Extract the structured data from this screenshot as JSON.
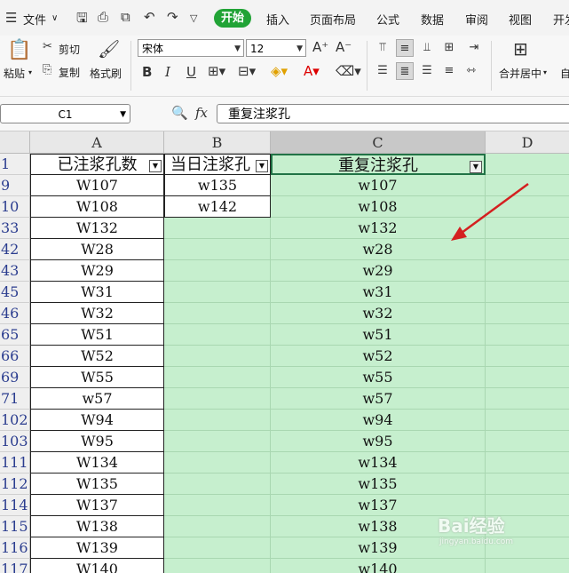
{
  "menubar": {
    "file_label": "文件",
    "tabs": [
      "开始",
      "插入",
      "页面布局",
      "公式",
      "数据",
      "审阅",
      "视图",
      "开发"
    ],
    "active_tab": "开始"
  },
  "ribbon": {
    "paste": "粘贴",
    "cut": "剪切",
    "copy": "复制",
    "format_painter": "格式刷",
    "font_name": "宋体",
    "font_size": "12",
    "merge_center": "合并居中",
    "auto": "自"
  },
  "formula_bar": {
    "cell_ref": "C1",
    "fx": "fx",
    "formula": "重复注浆孔"
  },
  "columns": [
    "A",
    "B",
    "C",
    "D"
  ],
  "selected_column": "C",
  "header_row": {
    "row": "1",
    "A": "已注浆孔数",
    "B": "当日注浆孔",
    "C": "重复注浆孔"
  },
  "rows": [
    {
      "row": "9",
      "A": "W107",
      "B": "w135",
      "C": "w107"
    },
    {
      "row": "10",
      "A": "W108",
      "B": "w142",
      "C": "w108"
    },
    {
      "row": "33",
      "A": "W132",
      "B": "",
      "C": "w132"
    },
    {
      "row": "42",
      "A": "W28",
      "B": "",
      "C": "w28"
    },
    {
      "row": "43",
      "A": "W29",
      "B": "",
      "C": "w29"
    },
    {
      "row": "45",
      "A": "W31",
      "B": "",
      "C": "w31"
    },
    {
      "row": "46",
      "A": "W32",
      "B": "",
      "C": "w32"
    },
    {
      "row": "65",
      "A": "W51",
      "B": "",
      "C": "w51"
    },
    {
      "row": "66",
      "A": "W52",
      "B": "",
      "C": "w52"
    },
    {
      "row": "69",
      "A": "W55",
      "B": "",
      "C": "w55"
    },
    {
      "row": "71",
      "A": "w57",
      "B": "",
      "C": "w57"
    },
    {
      "row": "102",
      "A": "W94",
      "B": "",
      "C": "w94"
    },
    {
      "row": "103",
      "A": "W95",
      "B": "",
      "C": "w95"
    },
    {
      "row": "111",
      "A": "W134",
      "B": "",
      "C": "w134"
    },
    {
      "row": "112",
      "A": "W135",
      "B": "",
      "C": "w135"
    },
    {
      "row": "114",
      "A": "W137",
      "B": "",
      "C": "w137"
    },
    {
      "row": "115",
      "A": "W138",
      "B": "",
      "C": "w138"
    },
    {
      "row": "116",
      "A": "W139",
      "B": "",
      "C": "w139"
    },
    {
      "row": "117",
      "A": "W140",
      "B": "",
      "C": "w140"
    }
  ],
  "colors": {
    "accent_green": "#21a336",
    "highlight_fill": "#c6efce",
    "annotation_arrow": "#d42020"
  },
  "watermark": {
    "brand": "Bai经验",
    "url": "jingyan.baidu.com"
  }
}
